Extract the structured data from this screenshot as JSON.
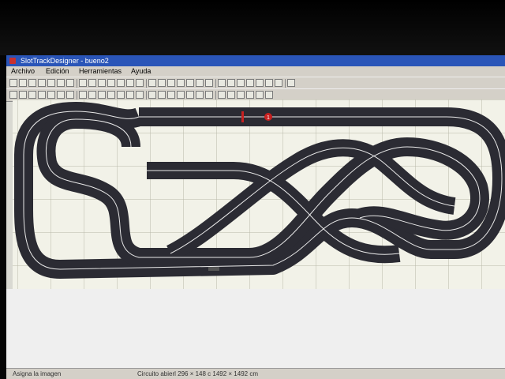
{
  "window": {
    "title": "SlotTrackDesigner - bueno2"
  },
  "menu": [
    {
      "label": "Archivo"
    },
    {
      "label": "Edición"
    },
    {
      "label": "Herramientas"
    },
    {
      "label": "Ayuda"
    }
  ],
  "toolbar1": {
    "button_count": 29
  },
  "toolbar2": {
    "button_count": 27
  },
  "track": {
    "lap_marker": "1"
  },
  "status": {
    "left": "Asigna la imagen",
    "middle": "Circuito abierl 296 × 148 c 1492 × 1492 cm"
  },
  "colors": {
    "track": "#2b2b33",
    "lane_line": "#e8e8e8",
    "grid": "#b8b8a8",
    "canvas": "#f2f2e8"
  }
}
